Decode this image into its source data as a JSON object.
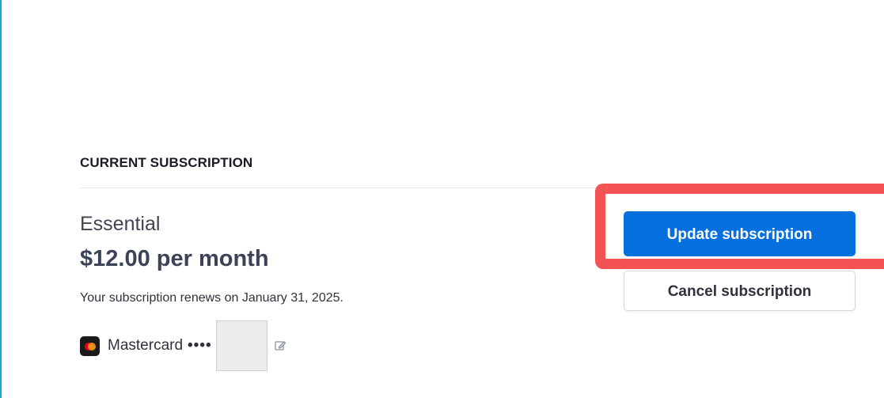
{
  "subscription": {
    "section_title": "CURRENT SUBSCRIPTION",
    "plan_name": "Essential",
    "price": "$12.00 per month",
    "renewal_text": "Your subscription renews on January 31, 2025."
  },
  "payment_method": {
    "brand": "Mastercard",
    "masked_digits": "••••",
    "brand_icon": "mastercard-icon",
    "edit_icon": "pencil-edit-icon"
  },
  "actions": {
    "update_label": "Update subscription",
    "cancel_label": "Cancel subscription"
  },
  "colors": {
    "primary_button": "#0570de",
    "highlight": "#f35353",
    "left_edge": "#1ea7d6"
  }
}
